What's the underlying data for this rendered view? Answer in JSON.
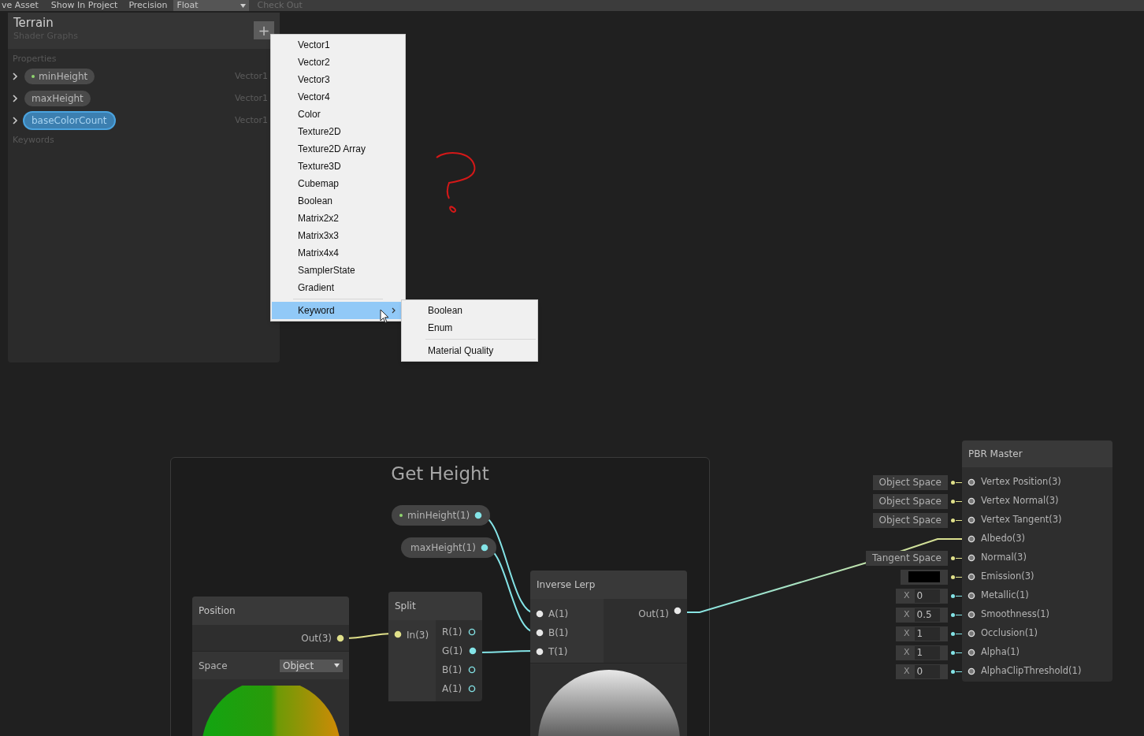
{
  "toolbar": [
    {
      "kind": "button",
      "label": "ve Asset",
      "disabled": false
    },
    {
      "kind": "button",
      "label": "Show In Project",
      "disabled": false
    },
    {
      "kind": "label",
      "label": "Precision",
      "disabled": false
    },
    {
      "kind": "dropdown",
      "label": "Float",
      "disabled": false
    },
    {
      "kind": "button",
      "label": "Check Out",
      "disabled": true
    }
  ],
  "blackboard": {
    "title": "Terrain",
    "subtitle": "Shader Graphs",
    "add_button": "+",
    "properties_label": "Properties",
    "properties": [
      {
        "name": "minHeight",
        "type": "Vector1",
        "dot": true,
        "selected": false
      },
      {
        "name": "maxHeight",
        "type": "Vector1",
        "dot": false,
        "selected": false
      },
      {
        "name": "baseColorCount",
        "type": "Vector1",
        "dot": false,
        "selected": true
      }
    ],
    "keywords_label": "Keywords"
  },
  "menu": {
    "groups": [
      {
        "items": [
          {
            "label": "Vector1",
            "highlighted": false,
            "submenu": false
          },
          {
            "label": "Vector2",
            "highlighted": false,
            "submenu": false
          },
          {
            "label": "Vector3",
            "highlighted": false,
            "submenu": false
          },
          {
            "label": "Vector4",
            "highlighted": false,
            "submenu": false
          },
          {
            "label": "Color",
            "highlighted": false,
            "submenu": false
          },
          {
            "label": "Texture2D",
            "highlighted": false,
            "submenu": false
          },
          {
            "label": "Texture2D Array",
            "highlighted": false,
            "submenu": false
          },
          {
            "label": "Texture3D",
            "highlighted": false,
            "submenu": false
          },
          {
            "label": "Cubemap",
            "highlighted": false,
            "submenu": false
          },
          {
            "label": "Boolean",
            "highlighted": false,
            "submenu": false
          },
          {
            "label": "Matrix2x2",
            "highlighted": false,
            "submenu": false
          },
          {
            "label": "Matrix3x3",
            "highlighted": false,
            "submenu": false
          },
          {
            "label": "Matrix4x4",
            "highlighted": false,
            "submenu": false
          },
          {
            "label": "SamplerState",
            "highlighted": false,
            "submenu": false
          },
          {
            "label": "Gradient",
            "highlighted": false,
            "submenu": false
          }
        ]
      },
      {
        "items": [
          {
            "label": "Keyword",
            "highlighted": true,
            "submenu": true
          }
        ]
      }
    ]
  },
  "submenu": {
    "groups": [
      {
        "items": [
          "Boolean",
          "Enum"
        ]
      },
      {
        "items": [
          "Material Quality"
        ]
      }
    ]
  },
  "graph": {
    "group_title": "Get Height",
    "property_nodes": [
      {
        "label": "minHeight(1)",
        "dot": true,
        "port": {
          "color": "#84e4e7",
          "connected": true
        }
      },
      {
        "label": "maxHeight(1)",
        "dot": false,
        "port": {
          "color": "#84e4e7",
          "connected": true
        }
      }
    ],
    "position_node": {
      "title": "Position",
      "output": {
        "label": "Out(3)",
        "color": "#e0e08a",
        "connected": true
      },
      "space_label": "Space",
      "space_value": "Object"
    },
    "split_node": {
      "title": "Split",
      "input": {
        "label": "In(3)",
        "color": "#e0e08a",
        "connected": true
      },
      "outputs": [
        {
          "label": "R(1)",
          "color": "#84e4e7",
          "connected": false
        },
        {
          "label": "G(1)",
          "color": "#84e4e7",
          "connected": true
        },
        {
          "label": "B(1)",
          "color": "#84e4e7",
          "connected": false
        },
        {
          "label": "A(1)",
          "color": "#84e4e7",
          "connected": false
        }
      ]
    },
    "inverse_lerp_node": {
      "title": "Inverse Lerp",
      "inputs": [
        {
          "label": "A(1)",
          "color": "#e8e8e8",
          "connected": true
        },
        {
          "label": "B(1)",
          "color": "#e8e8e8",
          "connected": true
        },
        {
          "label": "T(1)",
          "color": "#e8e8e8",
          "connected": true
        }
      ],
      "output": {
        "label": "Out(1)",
        "color": "#e8e8e8",
        "connected": true
      }
    },
    "master_node": {
      "title": "PBR Master",
      "ports": [
        {
          "label": "Vertex Position(3)",
          "color": "#e0e08a",
          "input": {
            "kind": "space",
            "text": "Object Space"
          }
        },
        {
          "label": "Vertex Normal(3)",
          "color": "#e0e08a",
          "input": {
            "kind": "space",
            "text": "Object Space"
          }
        },
        {
          "label": "Vertex Tangent(3)",
          "color": "#e0e08a",
          "input": {
            "kind": "space",
            "text": "Object Space"
          }
        },
        {
          "label": "Albedo(3)"
        },
        {
          "label": "Normal(3)",
          "color": "#e0e08a",
          "input": {
            "kind": "space",
            "text": "Tangent Space"
          }
        },
        {
          "label": "Emission(3)",
          "color": "#e0e08a",
          "input": {
            "kind": "color",
            "color": "#000000"
          }
        },
        {
          "label": "Metallic(1)",
          "color": "#84e4e7",
          "input": {
            "kind": "float",
            "axis": "X",
            "value": "0"
          }
        },
        {
          "label": "Smoothness(1)",
          "color": "#84e4e7",
          "input": {
            "kind": "float",
            "axis": "X",
            "value": "0.5"
          }
        },
        {
          "label": "Occlusion(1)",
          "color": "#84e4e7",
          "input": {
            "kind": "float",
            "axis": "X",
            "value": "1"
          }
        },
        {
          "label": "Alpha(1)",
          "color": "#84e4e7",
          "input": {
            "kind": "float",
            "axis": "X",
            "value": "1"
          }
        },
        {
          "label": "AlphaClipThreshold(1)",
          "color": "#84e4e7",
          "input": {
            "kind": "float",
            "axis": "X",
            "value": "0"
          }
        }
      ]
    }
  }
}
